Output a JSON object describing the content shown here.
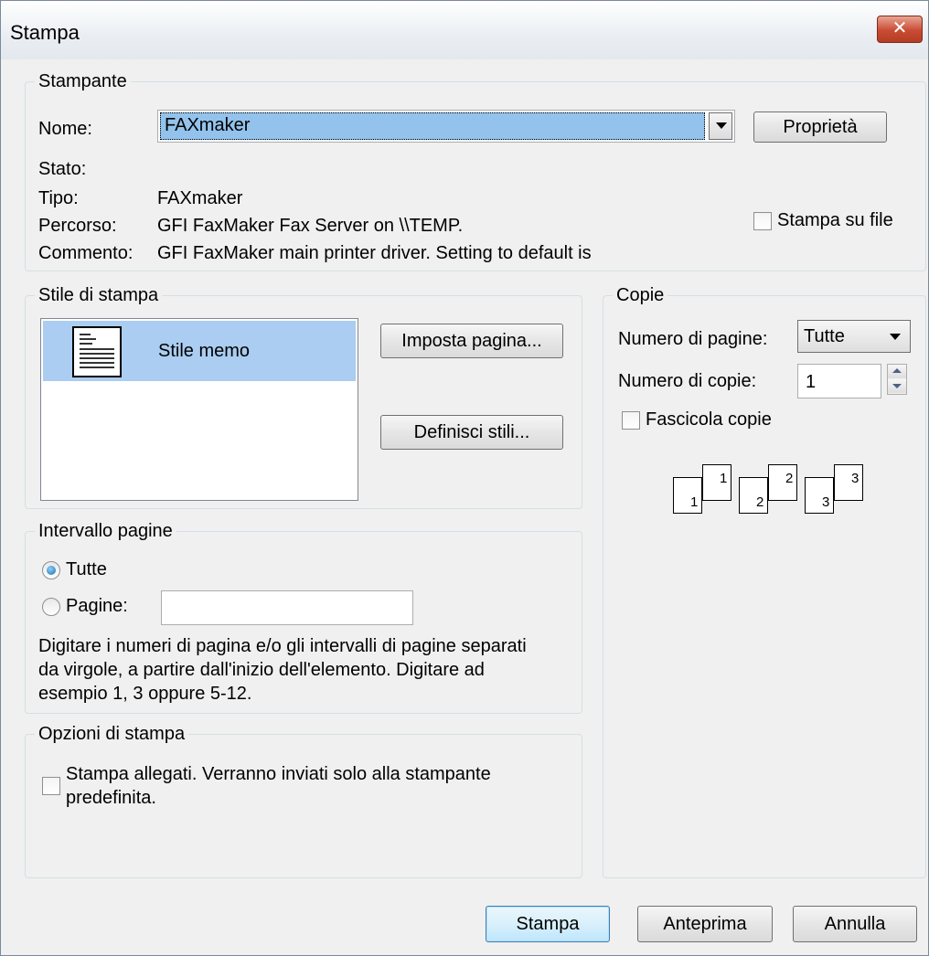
{
  "window": {
    "title": "Stampa",
    "close_label": "✕"
  },
  "printer": {
    "legend": "Stampante",
    "name_label": "Nome:",
    "name_value": "FAXmaker",
    "properties_button": "Proprietà",
    "status_label": "Stato:",
    "status_value": "",
    "type_label": "Tipo:",
    "type_value": "FAXmaker",
    "path_label": "Percorso:",
    "path_value": "GFI FaxMaker Fax Server on \\\\TEMP.",
    "comment_label": "Commento:",
    "comment_value": "GFI FaxMaker main printer driver. Setting to default is",
    "print_to_file_label": "Stampa su file",
    "print_to_file_checked": false
  },
  "print_style": {
    "legend": "Stile di stampa",
    "items": [
      {
        "label": "Stile memo",
        "selected": true
      }
    ],
    "page_setup_button": "Imposta pagina...",
    "define_styles_button": "Definisci stili..."
  },
  "copies": {
    "legend": "Copie",
    "pages_label": "Numero di pagine:",
    "pages_value": "Tutte",
    "copies_label": "Numero di copie:",
    "copies_value": "1",
    "collate_label": "Fascicola copie",
    "collate_checked": false,
    "collate_pages": [
      {
        "back": "1",
        "front": "1"
      },
      {
        "back": "2",
        "front": "2"
      },
      {
        "back": "3",
        "front": "3"
      }
    ]
  },
  "page_range": {
    "legend": "Intervallo pagine",
    "all_label": "Tutte",
    "all_selected": true,
    "pages_label": "Pagine:",
    "pages_value": "",
    "help_line1": "Digitare i numeri di pagina e/o gli intervalli di pagine separati",
    "help_line2": "da virgole, a partire dall'inizio dell'elemento. Digitare ad",
    "help_line3": "esempio 1, 3 oppure 5-12."
  },
  "print_options": {
    "legend": "Opzioni di stampa",
    "attachments_line1": "Stampa allegati. Verranno inviati solo alla stampante",
    "attachments_line2": "predefinita.",
    "attachments_checked": false
  },
  "buttons": {
    "print": "Stampa",
    "preview": "Anteprima",
    "cancel": "Annulla"
  },
  "colors": {
    "selection": "#93c3ec",
    "close": "#c94b33",
    "dialog_bg": "#f0f0f0"
  },
  "icons": {
    "memo_style": "memo-document-icon",
    "close": "close-icon",
    "dropdown": "chevron-down-icon"
  }
}
